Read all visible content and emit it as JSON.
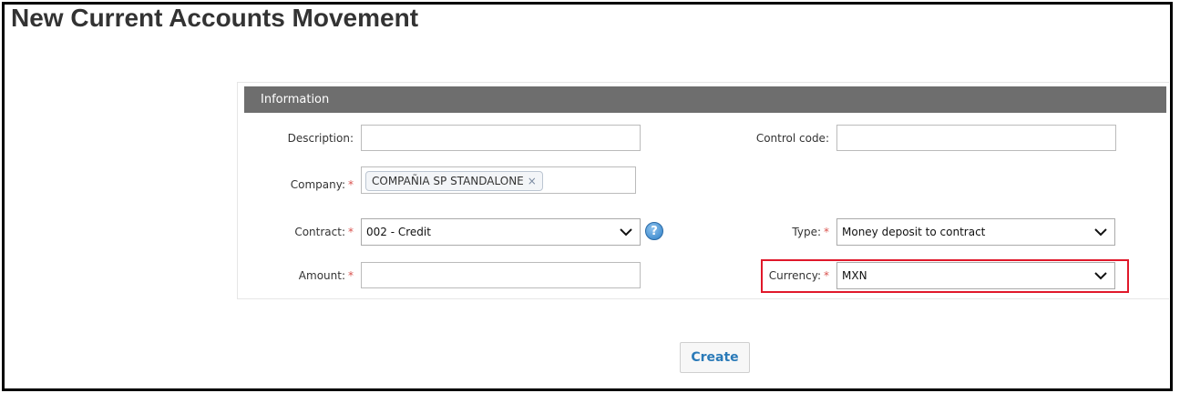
{
  "page": {
    "title": "New Current Accounts Movement"
  },
  "panel": {
    "header": "Information"
  },
  "form": {
    "description": {
      "label": "Description:",
      "value": ""
    },
    "control_code": {
      "label": "Control code:",
      "value": ""
    },
    "company": {
      "label": "Company:",
      "required_mark": "*",
      "tag": "COMPAÑIA SP STANDALONE",
      "remove_glyph": "×"
    },
    "contract": {
      "label": "Contract:",
      "required_mark": "*",
      "selected": "002 - Credit",
      "help_glyph": "?"
    },
    "type": {
      "label": "Type:",
      "required_mark": "*",
      "selected": "Money deposit to contract"
    },
    "amount": {
      "label": "Amount:",
      "required_mark": "*",
      "value": ""
    },
    "currency": {
      "label": "Currency:",
      "required_mark": "*",
      "selected": "MXN"
    }
  },
  "actions": {
    "create_label": "Create"
  },
  "colors": {
    "panel_header_bg": "#6e6e6e",
    "required": "#d9534f",
    "highlight": "#e0182a",
    "link_blue": "#2a7ab8"
  },
  "icons": {
    "dropdown": "chevron-down-icon",
    "help": "help-icon",
    "remove": "close-icon"
  }
}
